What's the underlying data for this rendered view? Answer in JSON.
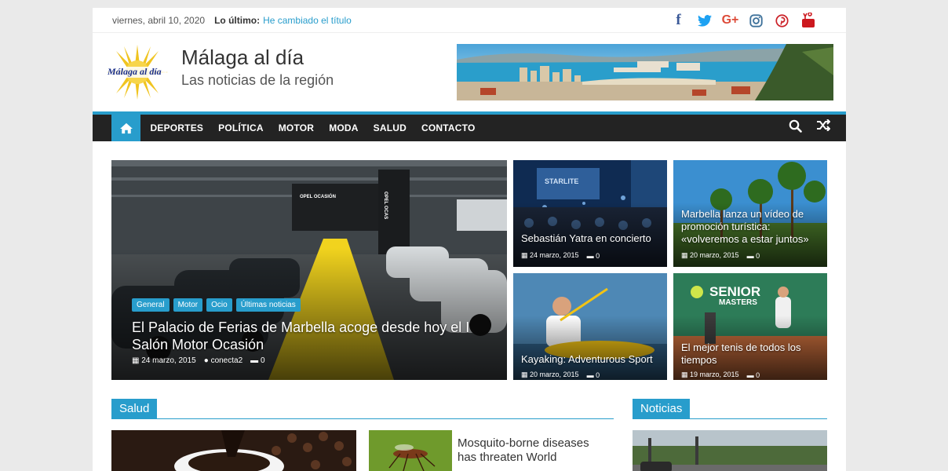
{
  "topbar": {
    "date": "viernes, abril 10, 2020",
    "latest_label": "Lo último:",
    "latest_link": "He cambiado el título"
  },
  "social": {
    "facebook": "f",
    "googleplus": "G+"
  },
  "header": {
    "logo_text": "Málaga al día",
    "title": "Málaga al día",
    "description": "Las noticias de la región"
  },
  "nav": {
    "items": [
      "DEPORTES",
      "POLÍTICA",
      "MOTOR",
      "MODA",
      "SALUD",
      "CONTACTO"
    ]
  },
  "featured": {
    "main": {
      "categories": [
        "General",
        "Motor",
        "Ocio",
        "Últimas noticias"
      ],
      "title": "El Palacio de Ferias de Marbella acoge desde hoy el I Salón Motor Ocasión",
      "date": "24 marzo, 2015",
      "author": "conecta2",
      "comments": "0",
      "sign1": "OPEL OCASIÓN",
      "sign2": "OPEL OCAS"
    },
    "items": [
      {
        "title": "Sebastián Yatra en concierto",
        "date": "24 marzo, 2015",
        "comments": "0",
        "sign": "STARLITE"
      },
      {
        "title": "Marbella lanza un vídeo de promoción turística: «volveremos a estar juntos»",
        "date": "20 marzo, 2015",
        "comments": "0"
      },
      {
        "title": "Kayaking: Adventurous Sport",
        "date": "20 marzo, 2015",
        "comments": "0"
      },
      {
        "title": "El mejor tenis de todos los tiempos",
        "date": "19 marzo, 2015",
        "comments": "0",
        "sign": "SENIOR",
        "sign2": "MASTERS"
      }
    ]
  },
  "sections": {
    "salud": "Salud",
    "noticias": "Noticias"
  },
  "salud_post": {
    "title": "Mosquito-borne diseases has threaten World"
  },
  "colors": {
    "accent": "#289dcc",
    "nav_bg": "#232323"
  }
}
